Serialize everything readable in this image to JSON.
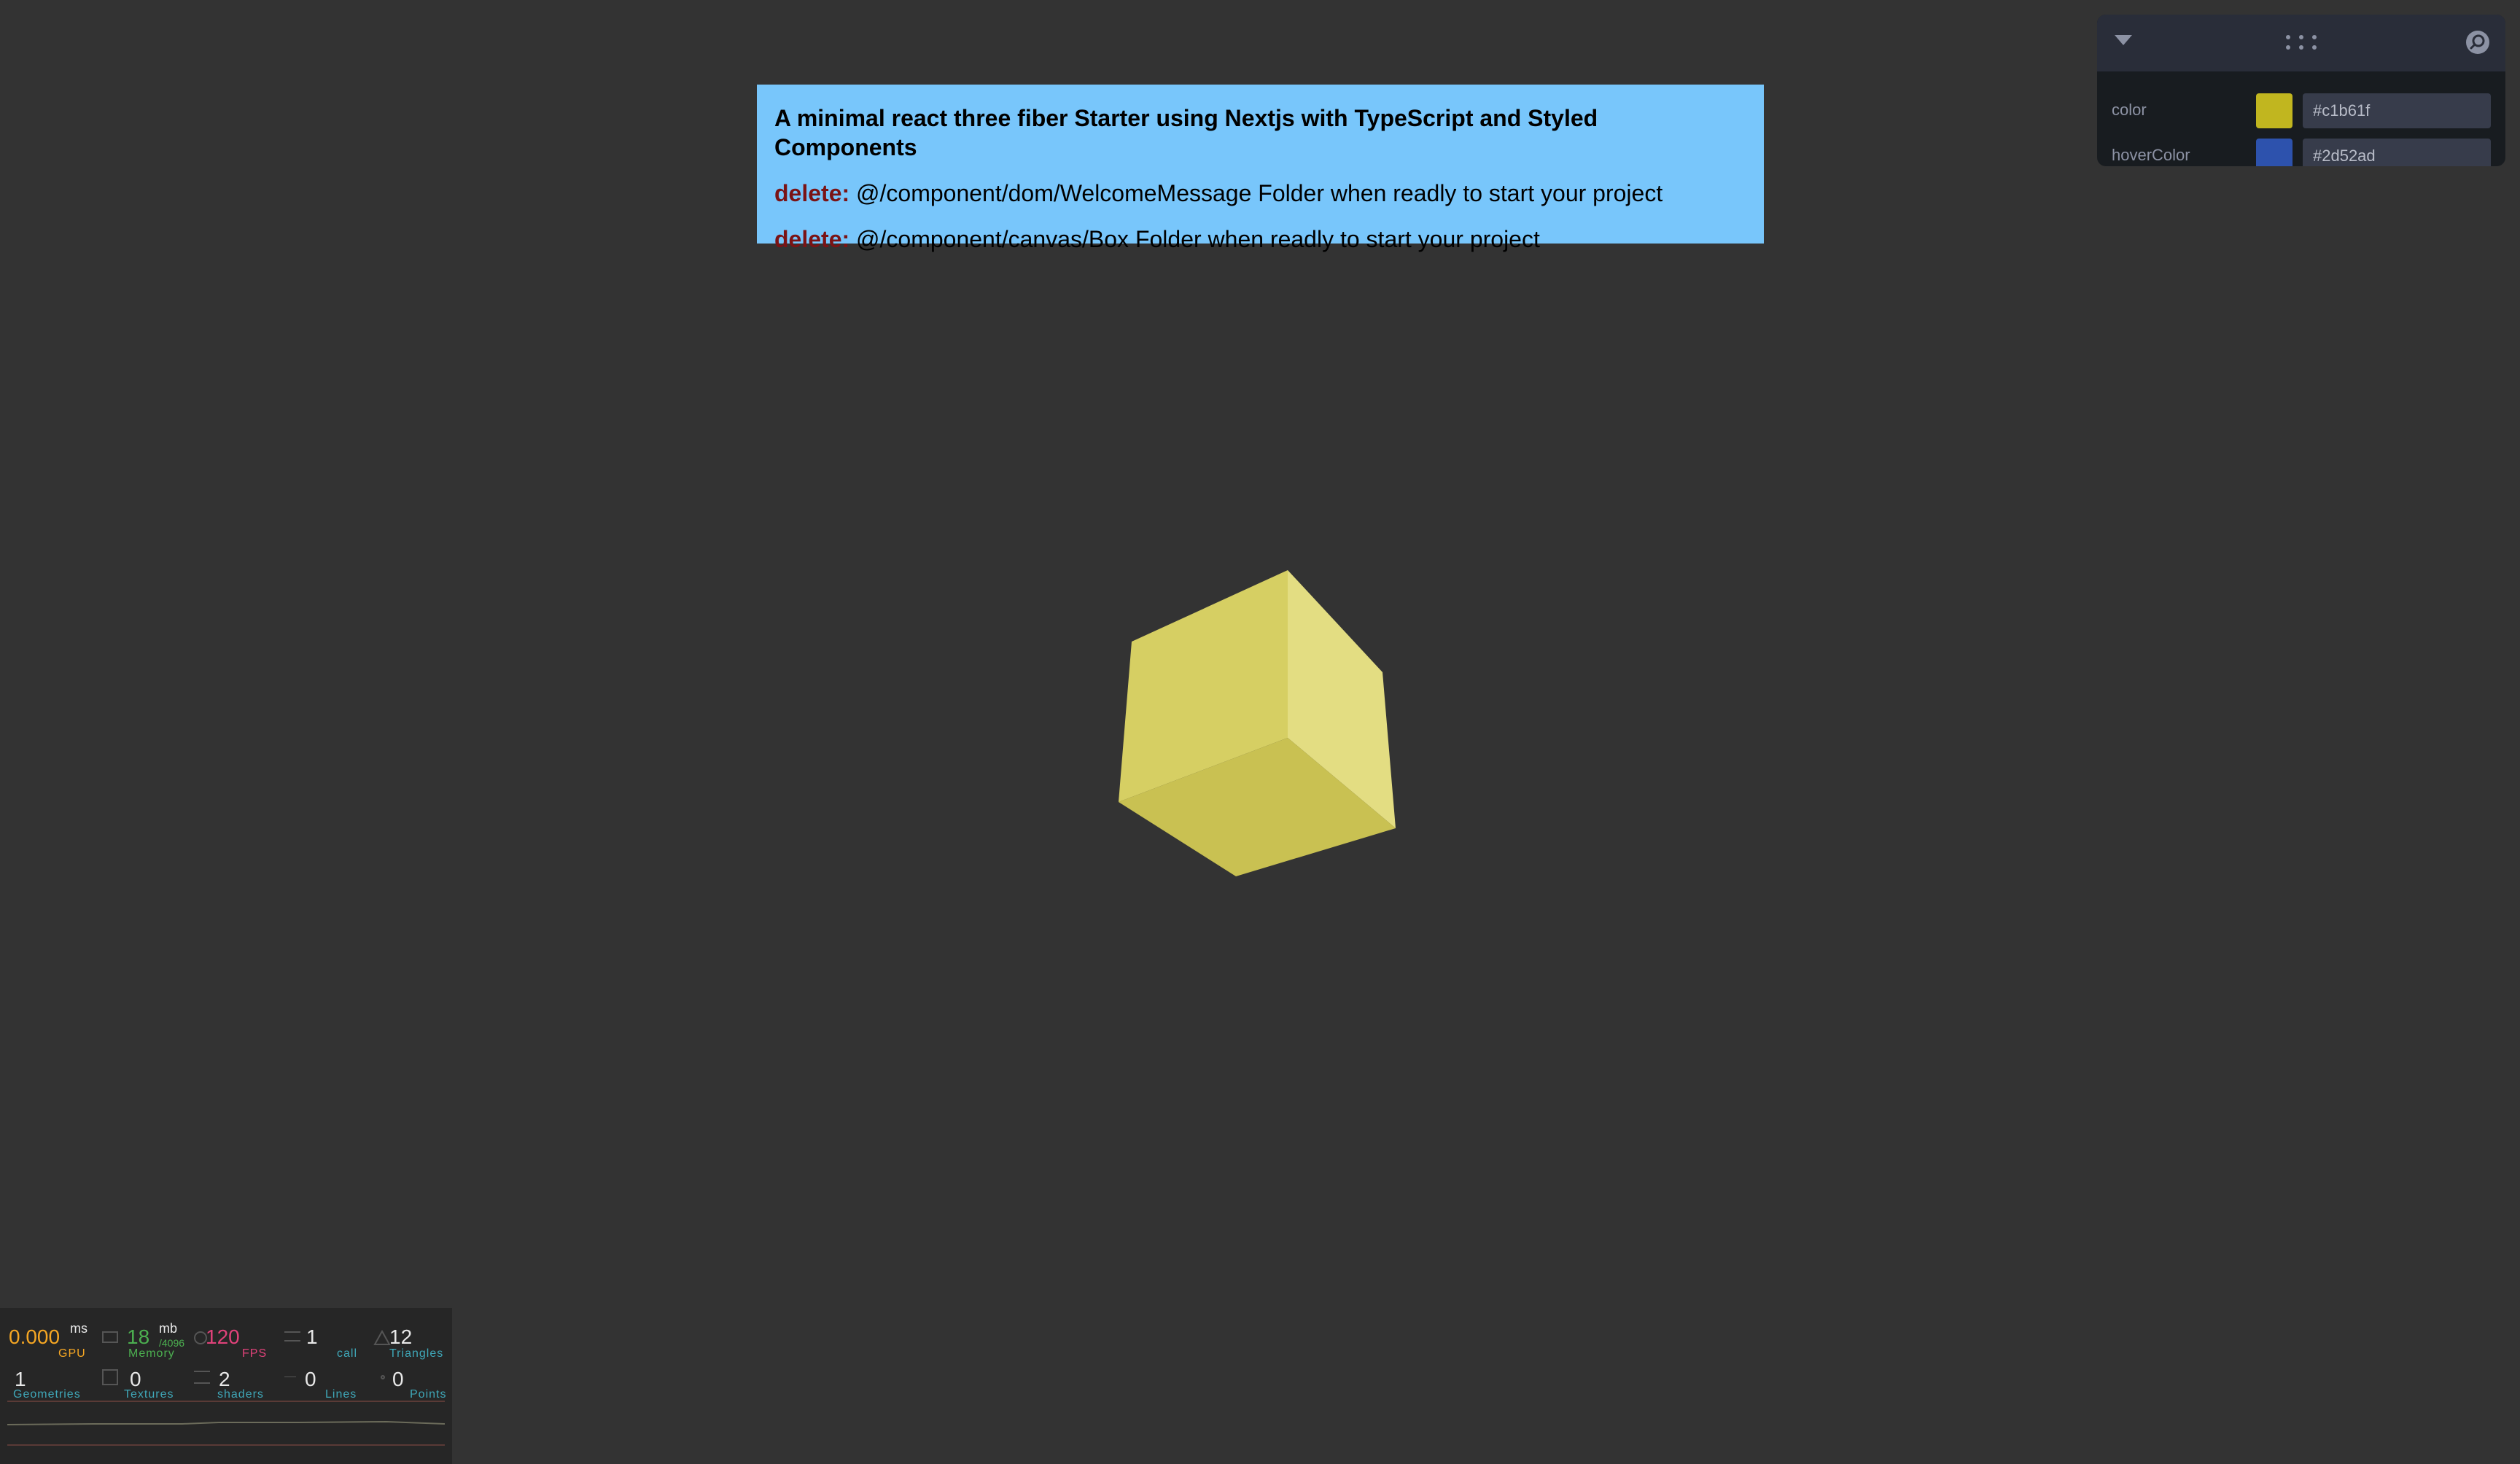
{
  "welcome": {
    "title": "A minimal react three fiber Starter using Nextjs with TypeScript and Styled Components",
    "lines": [
      {
        "prefix": "delete:",
        "text": " @/component/dom/WelcomeMessage Folder when readly to start your project"
      },
      {
        "prefix": "delete:",
        "text": " @/component/canvas/Box Folder when readly to start your project"
      }
    ]
  },
  "controls": {
    "header": {
      "collapse_icon": "caret-down-icon",
      "drag_icon": "drag-handle-icon",
      "search_icon": "search-icon"
    },
    "rows": [
      {
        "label": "color",
        "value": "#c1b61f",
        "swatch": "#c1b61f"
      },
      {
        "label": "hoverColor",
        "value": "#2d52ad",
        "swatch": "#2d52ad"
      }
    ]
  },
  "scene": {
    "cube_color": "#d6cf63"
  },
  "stats": {
    "gpu": {
      "value": "0.000",
      "unit": "ms",
      "name": "GPU",
      "color": "#f5a623"
    },
    "memory": {
      "value": "18",
      "unit": "mb",
      "extra": "/4096",
      "name": "Memory",
      "color": "#4caf50"
    },
    "fps": {
      "value": "120",
      "name": "FPS",
      "color": "#e0427a"
    },
    "calls": {
      "value": "1",
      "name": "call",
      "color": "#3fa7b8"
    },
    "triangles": {
      "value": "12",
      "name": "Triangles",
      "color": "#3fa7b8"
    },
    "geometries": {
      "value": "1",
      "name": "Geometries",
      "color": "#3fa7b8"
    },
    "textures": {
      "value": "0",
      "name": "Textures",
      "color": "#3fa7b8"
    },
    "shaders": {
      "value": "2",
      "name": "shaders",
      "color": "#3fa7b8"
    },
    "lines": {
      "value": "0",
      "name": "Lines",
      "color": "#3fa7b8"
    },
    "points": {
      "value": "0",
      "name": "Points",
      "color": "#3fa7b8"
    }
  }
}
